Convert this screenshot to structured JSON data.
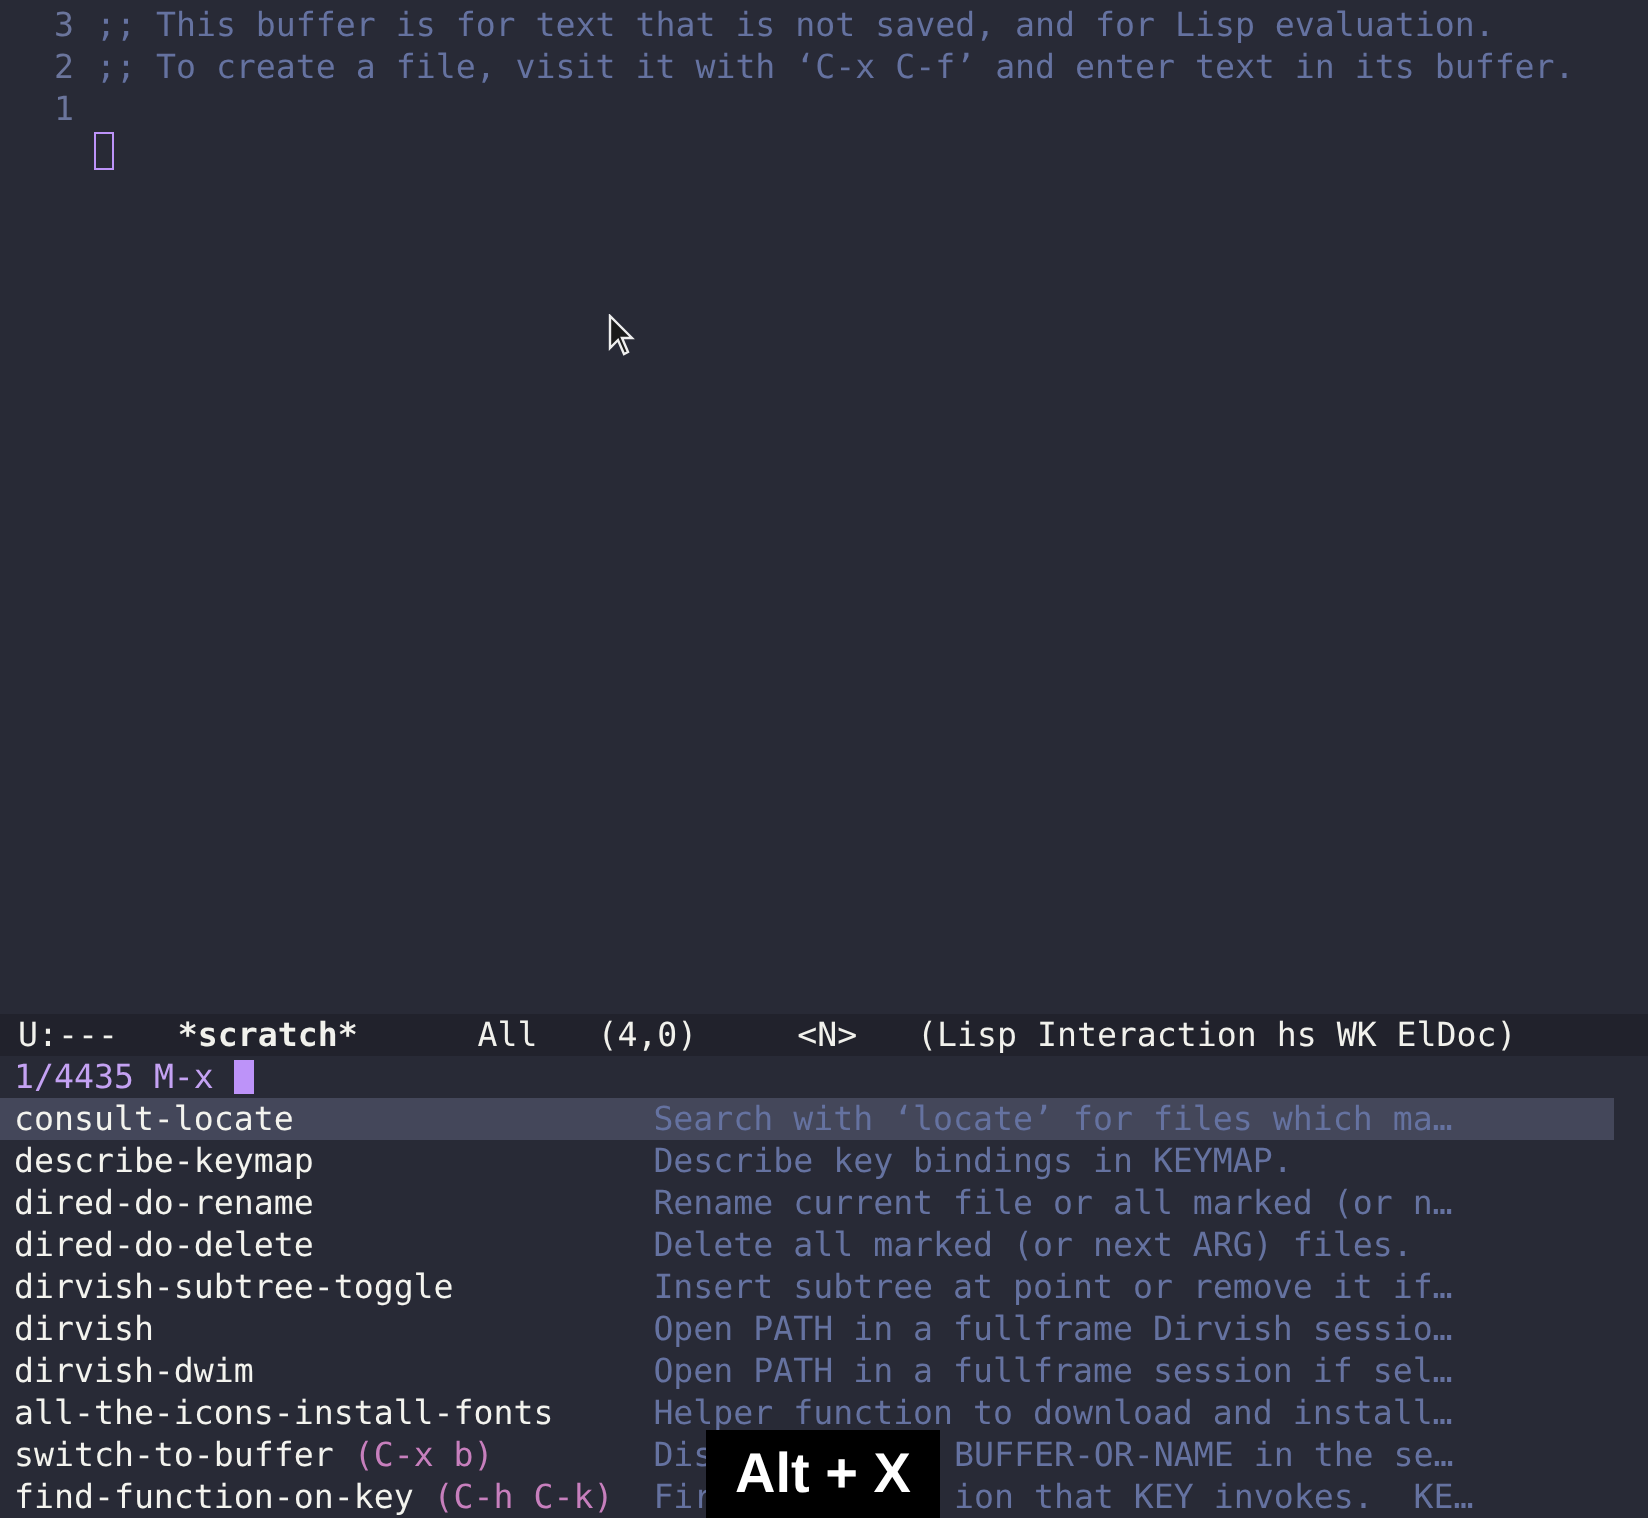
{
  "editor": {
    "lines": [
      {
        "kind": "text",
        "number": "3",
        "text": ";; This buffer is for text that is not saved, and for Lisp evaluation."
      },
      {
        "kind": "text",
        "number": "2",
        "text": ";; To create a file, visit it with ‘C-x C-f’ and enter text in its buffer."
      },
      {
        "kind": "text",
        "number": "1"
      },
      {
        "kind": "cursor"
      }
    ]
  },
  "mode_line": {
    "state": "U:---",
    "buffer": "*scratch*",
    "position": "All",
    "line_col": "(4,0)",
    "evil_state": "<N>",
    "modes": "(Lisp Interaction hs WK ElDoc)"
  },
  "minibuffer": {
    "count": "1/4435",
    "prompt": "M-x"
  },
  "candidates": [
    {
      "name": "consult-locate",
      "description": "Search with ‘locate’ for files which ma…",
      "selected": true
    },
    {
      "name": "describe-keymap",
      "description": "Describe key bindings in KEYMAP.",
      "selected": false
    },
    {
      "name": "dired-do-rename",
      "description": "Rename current file or all marked (or n…",
      "selected": false
    },
    {
      "name": "dired-do-delete",
      "description": "Delete all marked (or next ARG) files.",
      "selected": false
    },
    {
      "name": "dirvish-subtree-toggle",
      "description": "Insert subtree at point or remove it if…",
      "selected": false
    },
    {
      "name": "dirvish",
      "description": "Open PATH in a fullframe Dirvish sessio…",
      "selected": false
    },
    {
      "name": "dirvish-dwim",
      "description": "Open PATH in a fullframe session if sel…",
      "selected": false
    },
    {
      "name": "all-the-icons-install-fonts",
      "description": "Helper function to download and install…",
      "selected": false
    },
    {
      "name": "switch-to-buffer",
      "keybinding": "(C-x b)",
      "description": "Dis",
      "description_after": "BUFFER-OR-NAME in the se…",
      "selected": false
    },
    {
      "name": "find-function-on-key",
      "keybinding": "(C-h C-k)",
      "description": "Fir",
      "description_after": "ion that KEY invokes.  KE…",
      "selected": false
    }
  ],
  "key_overlay": {
    "text": "Alt + X"
  }
}
